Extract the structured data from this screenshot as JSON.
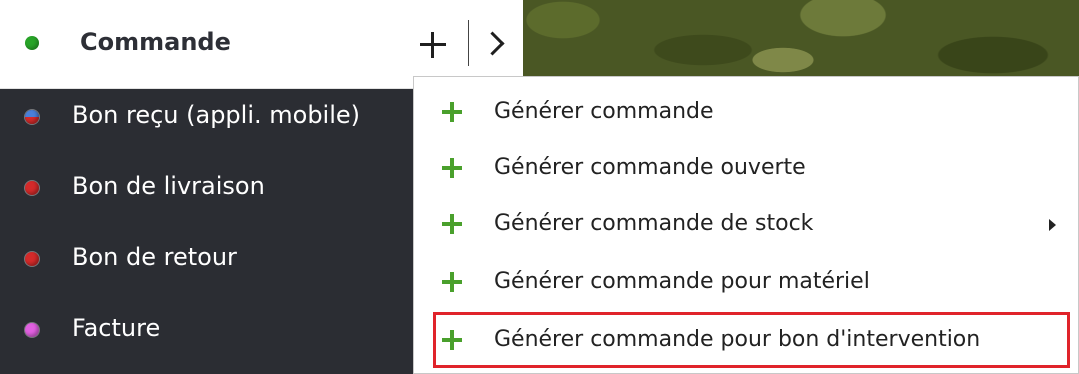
{
  "header": {
    "title": "Commande",
    "status_color": "#28a428",
    "add_icon": "plus-icon",
    "next_icon": "chevron-right-icon"
  },
  "documents": [
    {
      "label": "Bon reçu (appli. mobile)",
      "color_top": "#4a7fd8",
      "color_bottom": "#d42a2a"
    },
    {
      "label": "Bon de livraison",
      "color": "#d42a2a"
    },
    {
      "label": "Bon de retour",
      "color": "#d42a2a"
    },
    {
      "label": "Facture",
      "color": "#e060e0"
    }
  ],
  "context_menu": {
    "items": [
      {
        "label": "Générer commande",
        "icon": "plus-icon"
      },
      {
        "label": "Générer commande ouverte",
        "icon": "plus-icon"
      },
      {
        "label": "Générer commande de stock",
        "icon": "plus-icon",
        "has_submenu": true
      },
      {
        "label": "Générer commande pour matériel",
        "icon": "plus-icon"
      },
      {
        "label": "Générer commande pour bon d'intervention",
        "icon": "plus-icon",
        "highlighted": true
      }
    ],
    "highlight_color": "#e0232a",
    "icon_color": "#4aa02c"
  }
}
